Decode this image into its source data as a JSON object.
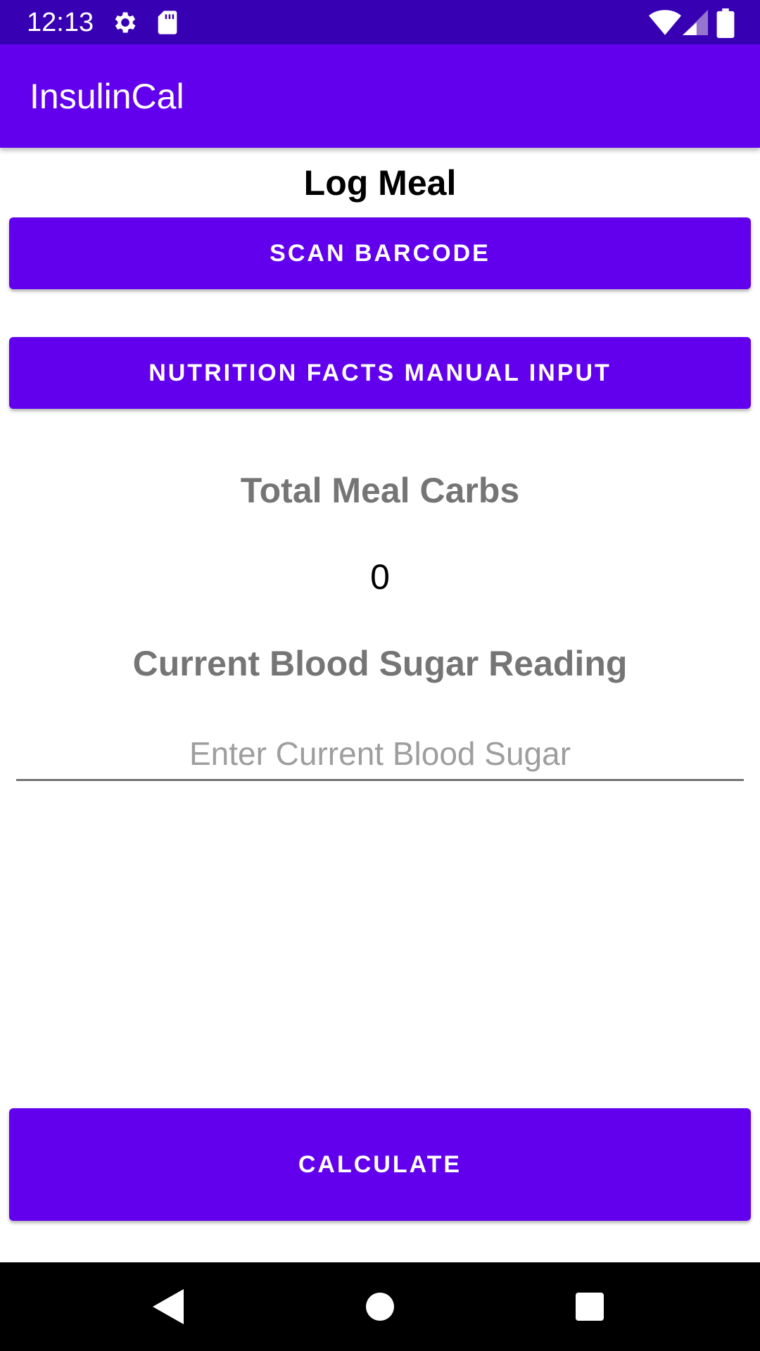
{
  "status_bar": {
    "time": "12:13",
    "icons": [
      "gear-icon",
      "sd-card-icon",
      "wifi-icon",
      "signal-icon",
      "battery-icon"
    ],
    "background_color": "#3700b3"
  },
  "app_bar": {
    "title": "InsulinCal",
    "background_color": "#6200ee"
  },
  "main": {
    "heading": "Log Meal",
    "scan_barcode_label": "SCAN BARCODE",
    "manual_input_label": "NUTRITION FACTS MANUAL INPUT",
    "total_carbs_label": "Total Meal Carbs",
    "total_carbs_value": "0",
    "blood_sugar_label": "Current Blood Sugar Reading",
    "blood_sugar_input": {
      "value": "",
      "placeholder": "Enter Current Blood Sugar"
    },
    "calculate_label": "CALCULATE",
    "accent_color": "#6200ee"
  },
  "nav_bar": {
    "icons": [
      "back-icon",
      "home-icon",
      "recents-icon"
    ]
  }
}
